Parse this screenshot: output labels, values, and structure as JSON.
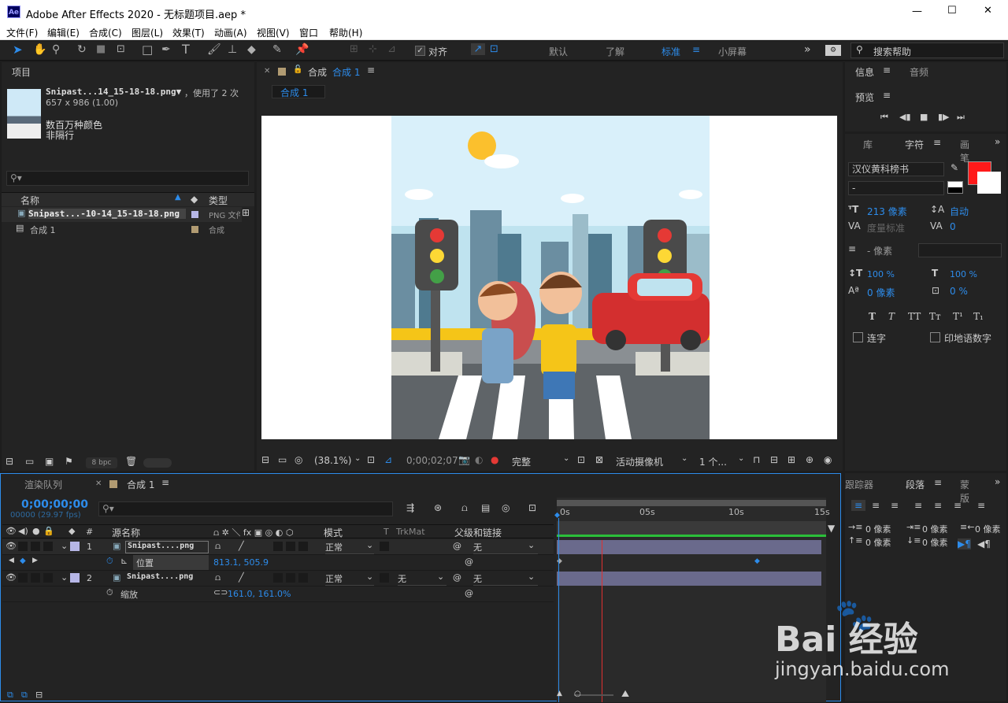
{
  "titlebar": {
    "app_icon": "Ae",
    "title": "Adobe After Effects 2020 - 无标题项目.aep *",
    "minimize": "—",
    "maximize": "☐",
    "close": "✕"
  },
  "menu": [
    "文件(F)",
    "编辑(E)",
    "合成(C)",
    "图层(L)",
    "效果(T)",
    "动画(A)",
    "视图(V)",
    "窗口",
    "帮助(H)"
  ],
  "toolbar": {
    "snap_label": "对齐",
    "workspaces": [
      "默认",
      "了解",
      "标准",
      "小屏幕"
    ],
    "active_workspace": "标准",
    "more": "»",
    "search_placeholder": "搜索帮助"
  },
  "project": {
    "title": "项目",
    "asset_name": "Snipast...14_15-18-18.png▼",
    "asset_usage": "，使用了 2 次",
    "asset_dims": "657 x 986 (1.00)",
    "asset_colors": "数百万种颜色",
    "asset_interlace": "非隔行",
    "col_name": "名称",
    "col_type": "类型",
    "items": [
      {
        "name": "Snipast...-10-14_15-18-18.png",
        "type": "PNG 文件"
      },
      {
        "name": "合成 1",
        "type": "合成"
      }
    ],
    "bpc": "8 bpc"
  },
  "comp_viewer": {
    "tab_label": "合成",
    "comp_name": "合成 1",
    "breadcrumb": "合成 1",
    "zoom": "(38.1%)",
    "timecode": "0;00;02;07",
    "resolution": "完整",
    "camera": "活动摄像机",
    "views": "1 个..."
  },
  "info": {
    "tab_info": "信息",
    "tab_audio": "音频",
    "preview": "预览"
  },
  "character": {
    "tab_lib": "库",
    "tab_char": "字符",
    "tab_para": "画笔",
    "font": "汉仪黄科榜书",
    "style": "-",
    "size": "213 像素",
    "leading": "自动",
    "kerning": "度量标准",
    "tracking": "0",
    "stroke": "- 像素",
    "vscale": "100 %",
    "hscale": "100 %",
    "baseline": "0 像素",
    "tsume": "0 %",
    "ligature": "连字",
    "hindi": "印地语数字",
    "fill_color": "#ff1a1a"
  },
  "paragraph": {
    "tab_tracker": "跟踪器",
    "tab_para": "段落",
    "tab_more": "蒙版",
    "indent_left": "0 像素",
    "indent_first": "0 像素",
    "indent_right": "0 像素",
    "space_before": "0 像素",
    "space_after": "0 像素"
  },
  "timeline": {
    "tab_render": "渲染队列",
    "tab_comp": "合成 1",
    "timecode": "0;00;00;00",
    "fps": "00000 (29.97 fps)",
    "col_num": "#",
    "col_source": "源名称",
    "col_mode": "模式",
    "col_t": "T",
    "col_trkmat": "TrkMat",
    "col_parent": "父级和链接",
    "ruler": [
      "0s",
      "05s",
      "10s",
      "15s"
    ],
    "layers": [
      {
        "num": "1",
        "name": "Snipast....png",
        "mode": "正常",
        "trkmat": "",
        "parent": "无",
        "prop": "位置",
        "prop_value": "813.1, 505.9"
      },
      {
        "num": "2",
        "name": "Snipast....png",
        "mode": "正常",
        "trkmat": "无",
        "parent": "无",
        "prop": "缩放",
        "prop_value": "161.0, 161.0%"
      }
    ],
    "playhead_fraction": 0.15
  },
  "watermark": {
    "brand": "Bai 经验",
    "url": "jingyan.baidu.com"
  }
}
